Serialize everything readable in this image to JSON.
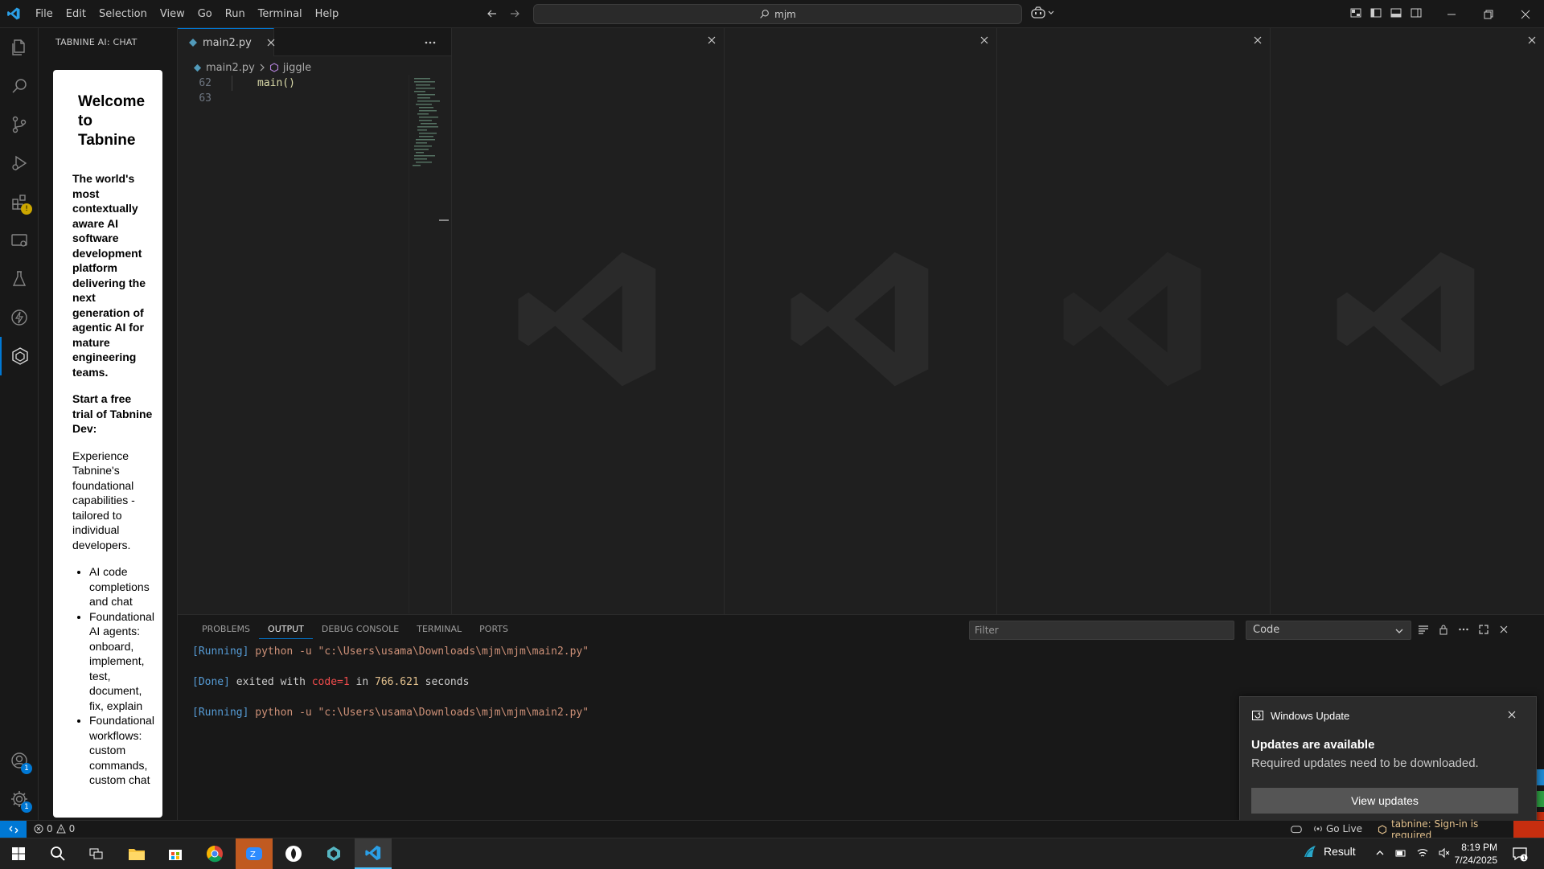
{
  "titlebar": {
    "menu": [
      "File",
      "Edit",
      "Selection",
      "View",
      "Go",
      "Run",
      "Terminal",
      "Help"
    ],
    "search_text": "mjm"
  },
  "sidebar": {
    "title": "TABNINE AI: CHAT",
    "panel": {
      "heading": "Welcome to Tabnine",
      "lead": "The world's most contextually aware AI software development platform delivering the next generation of agentic AI for mature engineering teams.",
      "trial": "Start a free trial of Tabnine Dev:",
      "description": "Experience Tabnine's foundational capabilities - tailored to individual developers.",
      "bullets": [
        "AI code completions and chat",
        "Foundational AI agents: onboard, implement, test, document, fix, explain",
        "Foundational workflows: custom commands, custom chat"
      ]
    }
  },
  "activitybar": {
    "icons": [
      "explorer-icon",
      "search-icon",
      "source-control-icon",
      "run-debug-icon",
      "extensions-icon",
      "remote-explorer-icon",
      "testing-icon",
      "lightning-icon",
      "tabnine-icon"
    ],
    "accounts_badge": "1",
    "settings_badge": "1"
  },
  "editor": {
    "tab_label": "main2.py",
    "breadcrumb": {
      "file": "main2.py",
      "symbol": "jiggle"
    },
    "lines": [
      {
        "number": "62",
        "code": "main()"
      },
      {
        "number": "63",
        "code": ""
      }
    ]
  },
  "panel": {
    "tabs": [
      "PROBLEMS",
      "OUTPUT",
      "DEBUG CONSOLE",
      "TERMINAL",
      "PORTS"
    ],
    "active_tab": "OUTPUT",
    "filter_placeholder": "Filter",
    "output_channel": "Code",
    "output": {
      "line1_tag": "[Running]",
      "line1_cmd": "python -u \"c:\\Users\\usama\\Downloads\\mjm\\mjm\\main2.py\"",
      "line2_tag": "[Done]",
      "line2_text": "exited with",
      "line2_code": "code=1",
      "line2_in": "in",
      "line2_secs": "766.621",
      "line2_unit": "seconds",
      "line3_tag": "[Running]",
      "line3_cmd": "python -u \"c:\\Users\\usama\\Downloads\\mjm\\mjm\\main2.py\""
    }
  },
  "toast": {
    "app": "Windows Update",
    "title": "Updates are available",
    "body": "Required updates need to be downloaded.",
    "button": "View updates"
  },
  "statusbar": {
    "errors": "0",
    "warnings": "0",
    "go_live": "Go Live",
    "tabnine": "tabnine: Sign-in is required"
  },
  "taskbar": {
    "weather": "Result",
    "time": "8:19 PM",
    "date": "7/24/2025",
    "notification_count": "1"
  },
  "colors": {
    "accent": "#0078d4",
    "background": "#1f1f1f",
    "chrome": "#181818",
    "error": "#f14c4c"
  }
}
